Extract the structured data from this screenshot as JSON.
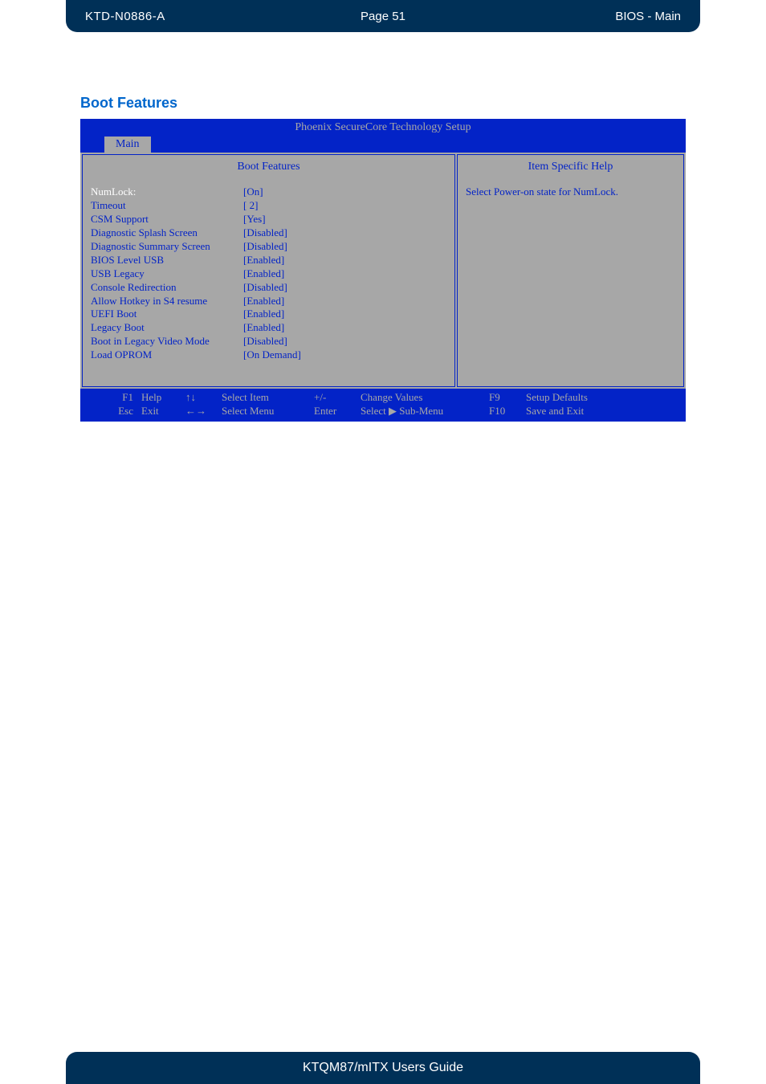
{
  "header": {
    "left": "KTD-N0886-A",
    "center": "Page 51",
    "right": "BIOS  - Main"
  },
  "section_title": "Boot Features",
  "bios": {
    "title": "Phoenix SecureCore Technology Setup",
    "tab_active": "Main",
    "left_title": "Boot Features",
    "right_title": "Item Specific Help",
    "help_text": "Select Power-on state for NumLock.",
    "rows": [
      {
        "label": "NumLock:",
        "value": "[On]",
        "selected": true
      },
      {
        "label": "Timeout",
        "value": "[  2]",
        "selected": false
      },
      {
        "label": "CSM Support",
        "value": "[Yes]",
        "selected": false
      },
      {
        "label": "Diagnostic Splash Screen",
        "value": "[Disabled]",
        "selected": false
      },
      {
        "label": "Diagnostic Summary Screen",
        "value": "[Disabled]",
        "selected": false
      },
      {
        "label": "BIOS Level USB",
        "value": "[Enabled]",
        "selected": false
      },
      {
        "label": "USB Legacy",
        "value": "[Enabled]",
        "selected": false
      },
      {
        "label": "Console Redirection",
        "value": "[Disabled]",
        "selected": false
      },
      {
        "label": "Allow Hotkey in S4 resume",
        "value": "[Enabled]",
        "selected": false
      },
      {
        "label": "UEFI Boot",
        "value": "[Enabled]",
        "selected": false
      },
      {
        "label": "Legacy Boot",
        "value": "[Enabled]",
        "selected": false
      },
      {
        "label": "Boot in Legacy Video Mode",
        "value": "[Disabled]",
        "selected": false
      },
      {
        "label": "Load OPROM",
        "value": "[On Demand]",
        "selected": false
      }
    ],
    "footer": {
      "r1": {
        "c1": "F1",
        "c2": "Help",
        "c3": "↑↓",
        "c4": "Select Item",
        "c5": "+/-",
        "c6": "Change Values",
        "c7": "F9",
        "c8": "Setup Defaults"
      },
      "r2": {
        "c1": "Esc",
        "c2": "Exit",
        "c3": "←→",
        "c4": "Select Menu",
        "c5": "Enter",
        "c6": "Select ▶ Sub-Menu",
        "c7": "F10",
        "c8": "Save and Exit"
      }
    }
  },
  "footer_text": "KTQM87/mITX Users Guide"
}
